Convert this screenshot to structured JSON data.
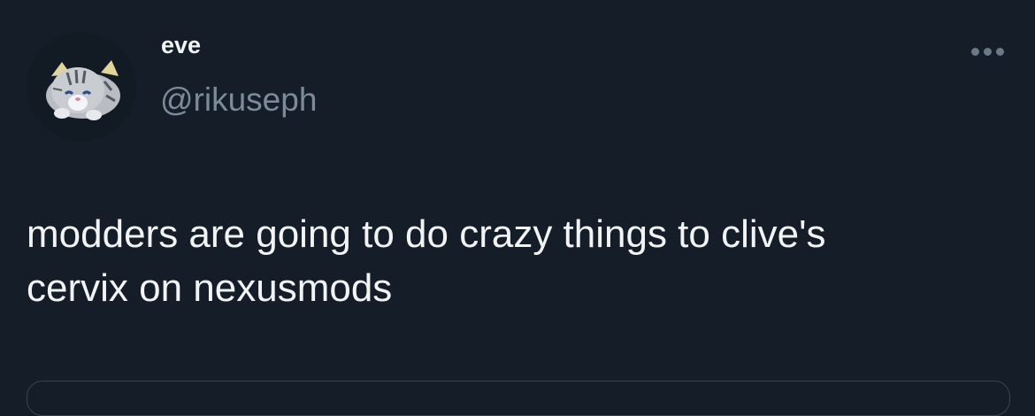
{
  "user": {
    "display_name": "eve",
    "handle": "@rikuseph",
    "avatar_icon": "plush-tiger-avatar-icon"
  },
  "tweet": {
    "text_line1": "modders are going to do crazy things to clive's",
    "text_line2": "cervix on nexusmods"
  },
  "actions": {
    "more_icon": "more-horizontal-icon"
  },
  "colors": {
    "background": "#151d28",
    "text_primary": "#f1f3f5",
    "text_secondary": "#7c8b99"
  }
}
